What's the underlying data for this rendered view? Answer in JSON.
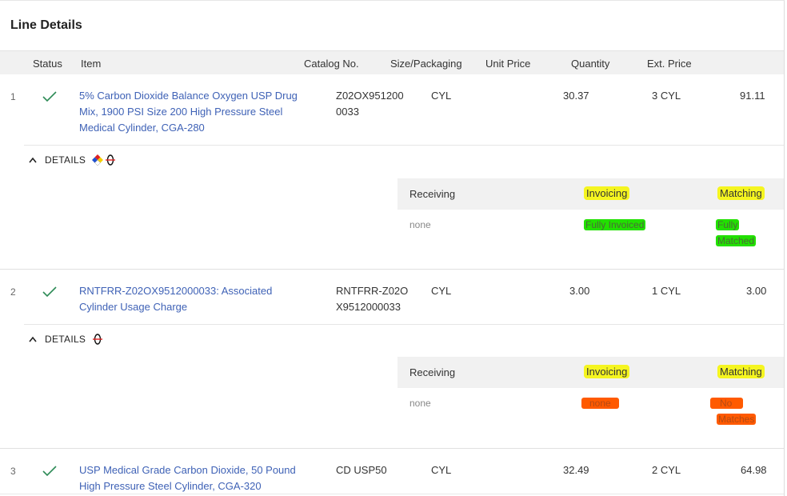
{
  "panel": {
    "title": "Line Details"
  },
  "columns": {
    "status": "Status",
    "item": "Item",
    "catalog": "Catalog No.",
    "size": "Size/Packaging",
    "unit_price": "Unit Price",
    "quantity": "Quantity",
    "ext_price": "Ext. Price"
  },
  "lines": [
    {
      "num": "1",
      "item_l1": "5% Carbon Dioxide Balance Oxygen USP Drug",
      "item_l2": "Mix, 1900 PSI Size 200 High Pressure Steel",
      "item_l3": "Medical Cylinder, CGA-280",
      "catalog_l1": "Z02OX951200",
      "catalog_l2": "0033",
      "size": "CYL",
      "unit_price": "30.37",
      "quantity": "3 CYL",
      "ext_price": "91.11",
      "details_label": "DETAILS",
      "receiving_label": "Receiving",
      "invoicing_label": "Invoicing",
      "matching_label": "Matching",
      "receiving_value": "none",
      "invoicing_value": "Fully Invoiced",
      "matching_l1": "Fully",
      "matching_l2": "Matched"
    },
    {
      "num": "2",
      "item_l1": "RNTFRR-Z02OX9512000033: Associated",
      "item_l2": "Cylinder Usage Charge",
      "catalog_l1": "RNTFRR-Z02O",
      "catalog_l2": "X9512000033",
      "size": "CYL",
      "unit_price": "3.00",
      "quantity": "1 CYL",
      "ext_price": "3.00",
      "details_label": "DETAILS",
      "receiving_label": "Receiving",
      "invoicing_label": "Invoicing",
      "matching_label": "Matching",
      "receiving_value": "none",
      "invoicing_value": "none",
      "matching_l1": "No",
      "matching_l2": "Matches"
    },
    {
      "num": "3",
      "item_l1": "USP Medical Grade Carbon Dioxide, 50 Pound",
      "item_l2": "High Pressure Steel Cylinder, CGA-320",
      "catalog_l1": "CD USP50",
      "size": "CYL",
      "unit_price": "32.49",
      "quantity": "2 CYL",
      "ext_price": "64.98"
    }
  ],
  "icons": {
    "status": "check-icon",
    "caret": "chevron-up-icon",
    "hazmat": "hazard-diamond-icon",
    "cylinder": "cylinder-icon"
  },
  "colors": {
    "link": "#3f62b6",
    "check": "#2e8b57",
    "highlight_yellow": "#f5f520",
    "highlight_green": "#22e000",
    "highlight_orange": "#ff5a00"
  }
}
